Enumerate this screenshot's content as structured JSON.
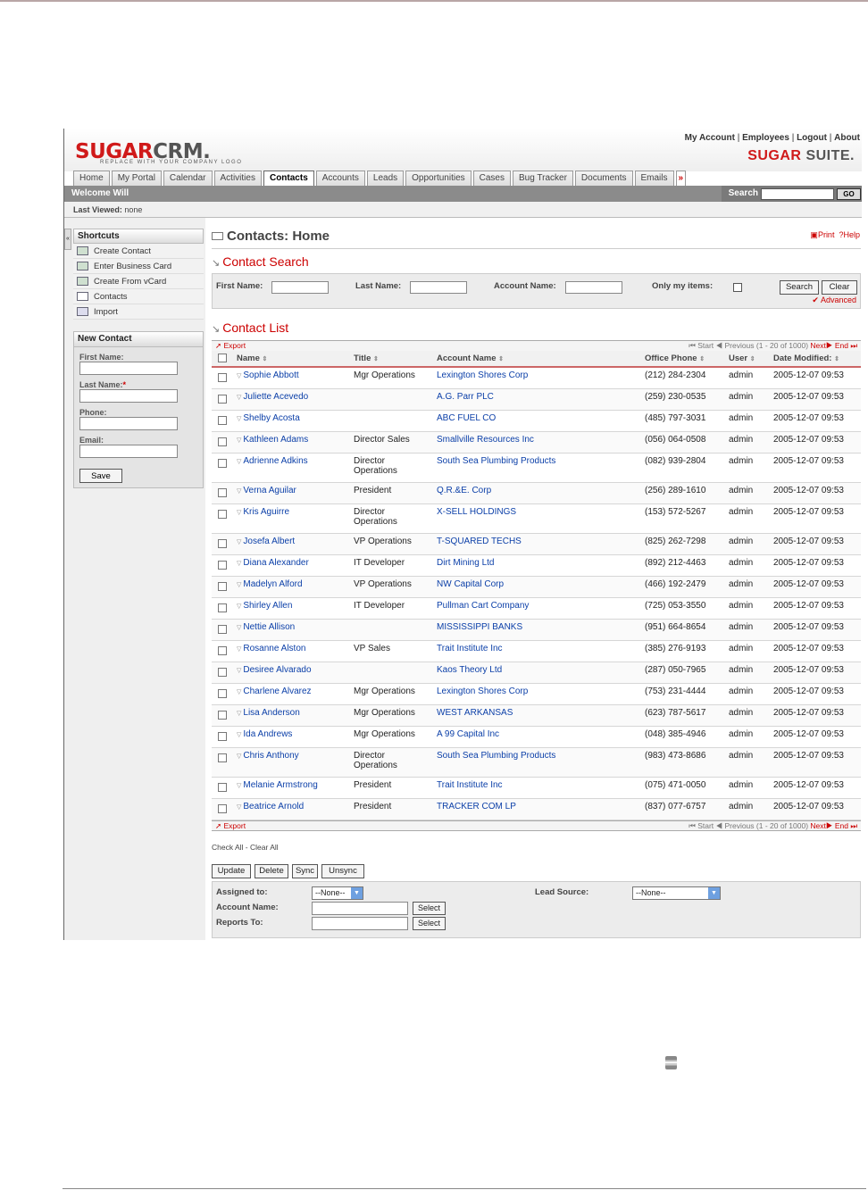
{
  "header": {
    "logo_main": "SUGAR",
    "logo_crm": "CRM.",
    "tagline": "REPLACE WITH YOUR COMPANY LOGO",
    "top_links": [
      "My Account",
      "Employees",
      "Logout",
      "About"
    ],
    "suite_brand_1": "SUGAR",
    "suite_brand_2": "SUITE."
  },
  "tabs": [
    "Home",
    "My Portal",
    "Calendar",
    "Activities",
    "Contacts",
    "Accounts",
    "Leads",
    "Opportunities",
    "Cases",
    "Bug Tracker",
    "Documents",
    "Emails"
  ],
  "active_tab": "Contacts",
  "welcome": {
    "text": "Welcome Will",
    "search_label": "Search",
    "go_label": "GO"
  },
  "last_viewed": {
    "label": "Last Viewed:",
    "value": "none"
  },
  "shortcuts": {
    "title": "Shortcuts",
    "items": [
      "Create Contact",
      "Enter Business Card",
      "Create From vCard",
      "Contacts",
      "Import"
    ]
  },
  "new_contact": {
    "title": "New Contact",
    "first_name": "First Name:",
    "last_name": "Last Name:",
    "required_mark": "*",
    "phone": "Phone:",
    "email": "Email:",
    "save": "Save"
  },
  "page": {
    "title": "Contacts: Home",
    "print": "Print",
    "help": "Help"
  },
  "search": {
    "title": "Contact Search",
    "first_name": "First Name:",
    "last_name": "Last Name:",
    "account_name": "Account Name:",
    "only_my": "Only my items:",
    "search_btn": "Search",
    "clear_btn": "Clear",
    "advanced": "Advanced"
  },
  "list": {
    "title": "Contact List",
    "export": "Export",
    "pager": {
      "start": "Start",
      "previous": "Previous",
      "range": "(1 - 20 of 1000)",
      "next": "Next",
      "end": "End"
    },
    "columns": [
      "Name",
      "Title",
      "Account Name",
      "Office Phone",
      "User",
      "Date Modified:"
    ],
    "rows": [
      {
        "name": "Sophie Abbott",
        "title": "Mgr Operations",
        "title2": "",
        "account": "Lexington Shores Corp",
        "phone": "(212) 284-2304",
        "user": "admin",
        "date": "2005-12-07 09:53"
      },
      {
        "name": "Juliette Acevedo",
        "title": "",
        "title2": "",
        "account": "A.G. Parr PLC",
        "phone": "(259) 230-0535",
        "user": "admin",
        "date": "2005-12-07 09:53"
      },
      {
        "name": "Shelby Acosta",
        "title": "",
        "title2": "",
        "account": "ABC FUEL CO",
        "phone": "(485) 797-3031",
        "user": "admin",
        "date": "2005-12-07 09:53"
      },
      {
        "name": "Kathleen Adams",
        "title": "Director Sales",
        "title2": "",
        "account": "Smallville Resources Inc",
        "phone": "(056) 064-0508",
        "user": "admin",
        "date": "2005-12-07 09:53"
      },
      {
        "name": "Adrienne Adkins",
        "title": "Director",
        "title2": "Operations",
        "account": "South Sea Plumbing Products",
        "phone": "(082) 939-2804",
        "user": "admin",
        "date": "2005-12-07 09:53"
      },
      {
        "name": "Verna Aguilar",
        "title": "President",
        "title2": "",
        "account": "Q.R.&E. Corp",
        "phone": "(256) 289-1610",
        "user": "admin",
        "date": "2005-12-07 09:53"
      },
      {
        "name": "Kris Aguirre",
        "title": "Director",
        "title2": "Operations",
        "account": "X-SELL HOLDINGS",
        "phone": "(153) 572-5267",
        "user": "admin",
        "date": "2005-12-07 09:53"
      },
      {
        "name": "Josefa Albert",
        "title": "VP Operations",
        "title2": "",
        "account": "T-SQUARED TECHS",
        "phone": "(825) 262-7298",
        "user": "admin",
        "date": "2005-12-07 09:53"
      },
      {
        "name": "Diana Alexander",
        "title": "IT Developer",
        "title2": "",
        "account": "Dirt Mining Ltd",
        "phone": "(892) 212-4463",
        "user": "admin",
        "date": "2005-12-07 09:53"
      },
      {
        "name": "Madelyn Alford",
        "title": "VP Operations",
        "title2": "",
        "account": "NW Capital Corp",
        "phone": "(466) 192-2479",
        "user": "admin",
        "date": "2005-12-07 09:53"
      },
      {
        "name": "Shirley Allen",
        "title": "IT Developer",
        "title2": "",
        "account": "Pullman Cart Company",
        "phone": "(725) 053-3550",
        "user": "admin",
        "date": "2005-12-07 09:53"
      },
      {
        "name": "Nettie Allison",
        "title": "",
        "title2": "",
        "account": "MISSISSIPPI BANKS",
        "phone": "(951) 664-8654",
        "user": "admin",
        "date": "2005-12-07 09:53"
      },
      {
        "name": "Rosanne Alston",
        "title": "VP Sales",
        "title2": "",
        "account": "Trait Institute Inc",
        "phone": "(385) 276-9193",
        "user": "admin",
        "date": "2005-12-07 09:53"
      },
      {
        "name": "Desiree Alvarado",
        "title": "",
        "title2": "",
        "account": "Kaos Theory Ltd",
        "phone": "(287) 050-7965",
        "user": "admin",
        "date": "2005-12-07 09:53"
      },
      {
        "name": "Charlene Alvarez",
        "title": "Mgr Operations",
        "title2": "",
        "account": "Lexington Shores Corp",
        "phone": "(753) 231-4444",
        "user": "admin",
        "date": "2005-12-07 09:53"
      },
      {
        "name": "Lisa Anderson",
        "title": "Mgr Operations",
        "title2": "",
        "account": "WEST ARKANSAS",
        "phone": "(623) 787-5617",
        "user": "admin",
        "date": "2005-12-07 09:53"
      },
      {
        "name": "Ida Andrews",
        "title": "Mgr Operations",
        "title2": "",
        "account": "A 99 Capital Inc",
        "phone": "(048) 385-4946",
        "user": "admin",
        "date": "2005-12-07 09:53"
      },
      {
        "name": "Chris Anthony",
        "title": "Director",
        "title2": "Operations",
        "account": "South Sea Plumbing Products",
        "phone": "(983) 473-8686",
        "user": "admin",
        "date": "2005-12-07 09:53"
      },
      {
        "name": "Melanie Armstrong",
        "title": "President",
        "title2": "",
        "account": "Trait Institute Inc",
        "phone": "(075) 471-0050",
        "user": "admin",
        "date": "2005-12-07 09:53"
      },
      {
        "name": "Beatrice Arnold",
        "title": "President",
        "title2": "",
        "account": "TRACKER COM LP",
        "phone": "(837) 077-6757",
        "user": "admin",
        "date": "2005-12-07 09:53"
      }
    ],
    "check_all": "Check All",
    "clear_all": "Clear All"
  },
  "mass_update": {
    "buttons": [
      "Update",
      "Delete",
      "Sync",
      "Unsync"
    ],
    "assigned_to": "Assigned to:",
    "assigned_value": "--None--",
    "account_name": "Account Name:",
    "reports_to": "Reports To:",
    "select": "Select",
    "lead_source": "Lead Source:",
    "lead_source_value": "--None--"
  }
}
